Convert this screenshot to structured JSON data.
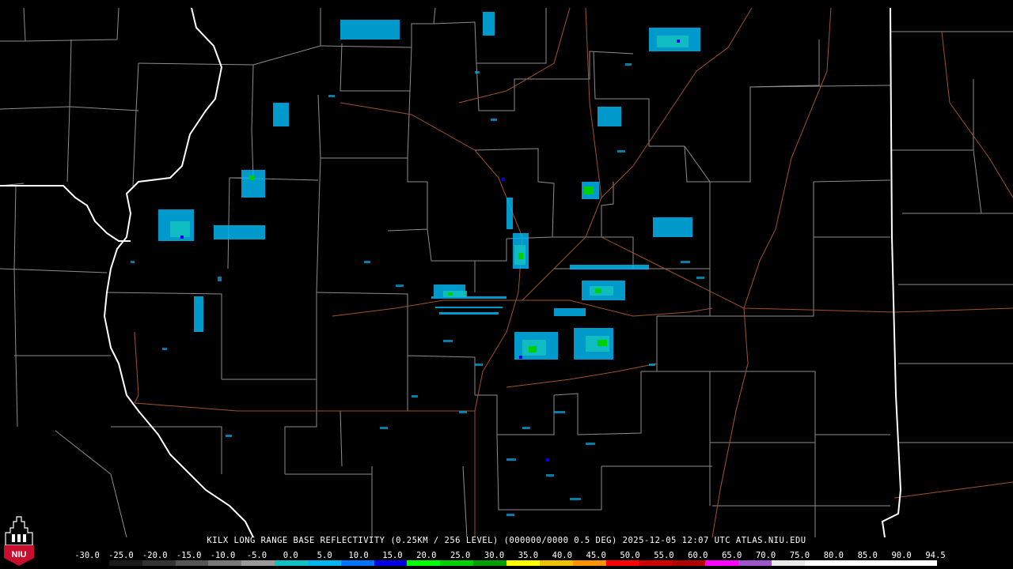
{
  "title": "KILX LONG RANGE BASE REFLECTIVITY (0.25KM / 256 LEVEL) (000000/0000 0.5 DEG) 2025-12-05 12:07 UTC  ATLAS.NIU.EDU",
  "logo": {
    "text": "NIU",
    "color": "#c8102e"
  },
  "scale": {
    "labels": [
      "-30.0",
      "-25.0",
      "-20.0",
      "-15.0",
      "-10.0",
      "-5.0",
      "0.0",
      "5.0",
      "10.0",
      "15.0",
      "20.0",
      "25.0",
      "30.0",
      "35.0",
      "40.0",
      "45.0",
      "50.0",
      "55.0",
      "60.0",
      "65.0",
      "70.0",
      "75.0",
      "80.0",
      "85.0",
      "90.0",
      "94.5"
    ],
    "colors": [
      "#000000",
      "#1a1a1a",
      "#333333",
      "#555555",
      "#777777",
      "#999999",
      "#10c0c0",
      "#00b4f0",
      "#0074ff",
      "#0000e8",
      "#00ff00",
      "#00d000",
      "#00a000",
      "#ffff00",
      "#f0c000",
      "#ff9000",
      "#ff0000",
      "#d00000",
      "#b00000",
      "#ff00ff",
      "#9c55c9",
      "#e8e8e8",
      "#ffffff",
      "#ffffff",
      "#ffffff",
      "#ffffff"
    ]
  },
  "colors": {
    "county_lines": "#8c8c8c",
    "state_lines": "#ffffff",
    "highways": "#a0522d",
    "echo_light": "#00b4f0",
    "echo_cyan": "#10c0c0",
    "echo_green": "#00d000",
    "echo_blue": "#0000e8"
  }
}
